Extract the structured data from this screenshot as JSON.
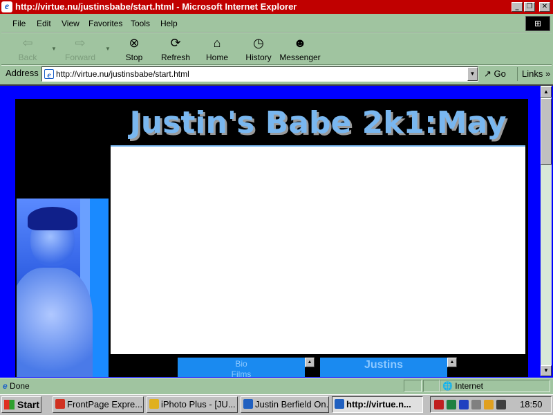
{
  "window": {
    "title": "http://virtue.nu/justinsbabe/start.html - Microsoft Internet Explorer",
    "buttons": [
      "minimize",
      "restore",
      "close"
    ]
  },
  "menu": {
    "items": [
      "File",
      "Edit",
      "View",
      "Favorites",
      "Tools",
      "Help"
    ]
  },
  "toolbar": {
    "back": "Back",
    "forward": "Forward",
    "stop": "Stop",
    "refresh": "Refresh",
    "home": "Home",
    "history": "History",
    "messenger": "Messenger"
  },
  "address": {
    "label": "Address",
    "url": "http://virtue.nu/justinsbabe/start.html",
    "go": "Go",
    "links": "Links"
  },
  "page": {
    "banner_title": "Justin's Babe 2k1:May",
    "mini_left": [
      "Bio",
      "Films"
    ],
    "mini_right": "Justins"
  },
  "status": {
    "text": "Done",
    "zone": "Internet"
  },
  "taskbar": {
    "start": "Start",
    "tasks": [
      "FrontPage Expre...",
      "iPhoto Plus - [JU...",
      "Justin Berfield On...",
      "http://virtue.n..."
    ],
    "clock": "18:50"
  },
  "colors": {
    "title_bar": "#c00000",
    "chrome": "#a0c4a0",
    "page_bg": "#0000ff",
    "banner_text": "#79b7f0"
  }
}
